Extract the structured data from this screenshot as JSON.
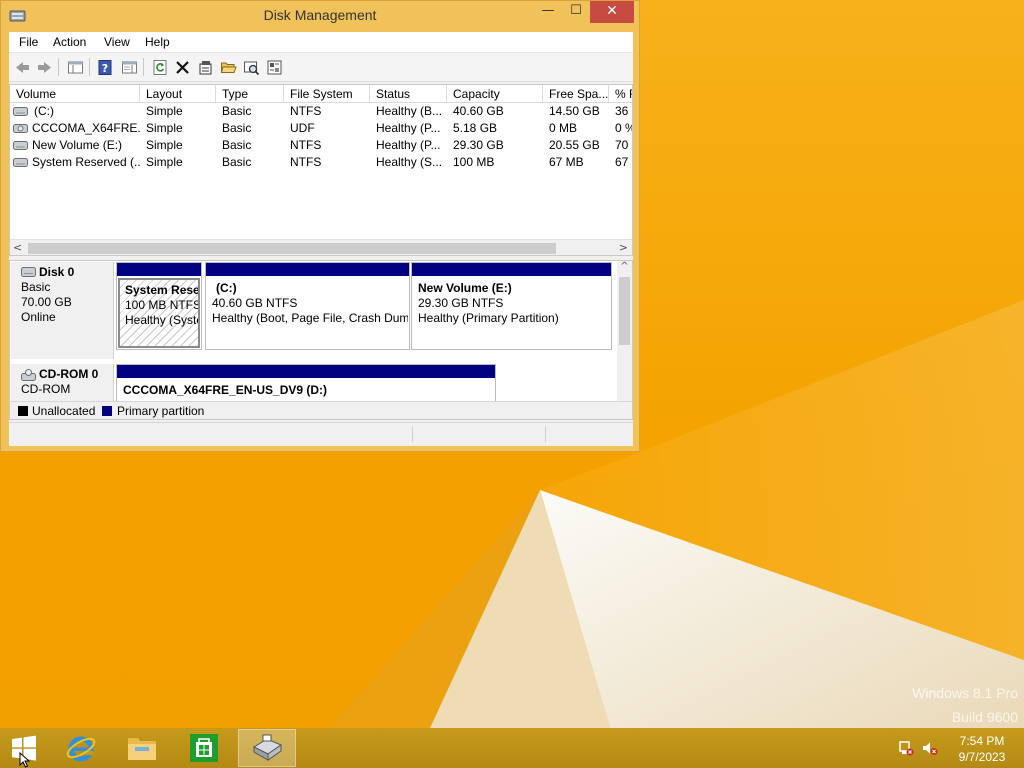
{
  "window": {
    "title": "Disk Management",
    "controls": {
      "minimize": "—",
      "maximize": "☐",
      "close": "✕"
    }
  },
  "menu": [
    "File",
    "Action",
    "View",
    "Help"
  ],
  "toolbar_icons": [
    "back-arrow-icon",
    "forward-arrow-icon",
    "console-tree-icon",
    "help-icon",
    "details-pane-icon",
    "refresh-icon",
    "delete-icon",
    "properties-icon",
    "open-folder-icon",
    "rescan-disks-icon",
    "view-settings-icon"
  ],
  "volume_list": {
    "columns": [
      "Volume",
      "Layout",
      "Type",
      "File System",
      "Status",
      "Capacity",
      "Free Spa...",
      "% F"
    ],
    "rows": [
      {
        "volume": "(C:)",
        "layout": "Simple",
        "type": "Basic",
        "fs": "NTFS",
        "status": "Healthy (B...",
        "capacity": "40.60 GB",
        "free": "14.50 GB",
        "pct": "36"
      },
      {
        "volume": "CCCOMA_X64FRE...",
        "layout": "Simple",
        "type": "Basic",
        "fs": "UDF",
        "status": "Healthy (P...",
        "capacity": "5.18 GB",
        "free": "0 MB",
        "pct": "0 %"
      },
      {
        "volume": "New Volume (E:)",
        "layout": "Simple",
        "type": "Basic",
        "fs": "NTFS",
        "status": "Healthy (P...",
        "capacity": "29.30 GB",
        "free": "20.55 GB",
        "pct": "70"
      },
      {
        "volume": "System Reserved (...",
        "layout": "Simple",
        "type": "Basic",
        "fs": "NTFS",
        "status": "Healthy (S...",
        "capacity": "100 MB",
        "free": "67 MB",
        "pct": "67"
      }
    ],
    "scroll": {
      "left": "<",
      "right": ">"
    }
  },
  "disks": [
    {
      "name": "Disk 0",
      "type": "Basic",
      "size": "70.00 GB",
      "state": "Online",
      "partitions": [
        {
          "name": "System Reser",
          "size": "100 MB NTFS",
          "status": "Healthy (Syste"
        },
        {
          "name": "(C:)",
          "size": "40.60 GB NTFS",
          "status": "Healthy (Boot, Page File, Crash Dum"
        },
        {
          "name": "New Volume  (E:)",
          "size": "29.30 GB NTFS",
          "status": "Healthy (Primary Partition)"
        }
      ]
    },
    {
      "name": "CD-ROM 0",
      "type": "CD-ROM",
      "partitions": [
        {
          "name": "CCCOMA_X64FRE_EN-US_DV9  (D:)"
        }
      ]
    }
  ],
  "pane_scroll": {
    "up": "^",
    "down": "v"
  },
  "legend": [
    {
      "label": "Unallocated",
      "color": "#000000"
    },
    {
      "label": "Primary partition",
      "color": "#000080"
    }
  ],
  "watermark": {
    "line1": "Windows 8.1 Pro",
    "line2": "Build 9600"
  },
  "taskbar": {
    "apps": [
      "start-icon",
      "internet-explorer-icon",
      "file-explorer-icon",
      "store-icon",
      "disk-management-icon"
    ],
    "clock": {
      "time": "7:54 PM",
      "date": "9/7/2023"
    }
  }
}
